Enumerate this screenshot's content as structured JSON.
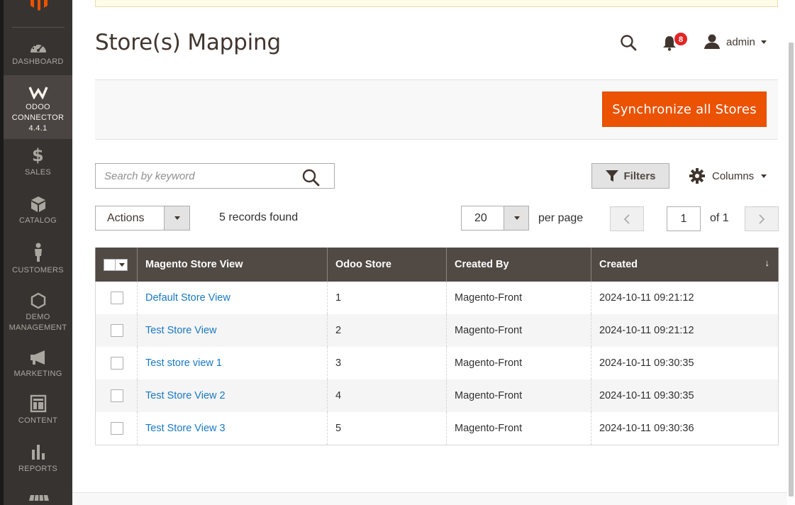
{
  "sidebar": {
    "items": [
      {
        "label": "DASHBOARD",
        "icon": "dashboard-icon"
      },
      {
        "label": "ODOO CONNECTOR 4.4.1",
        "label_lines": [
          "ODOO",
          "CONNECTOR",
          "4.4.1"
        ],
        "icon": "odoo-connector-icon",
        "active": true
      },
      {
        "label": "SALES",
        "icon": "dollar-icon"
      },
      {
        "label": "CATALOG",
        "icon": "box-icon"
      },
      {
        "label": "CUSTOMERS",
        "icon": "person-icon"
      },
      {
        "label": "DEMO MANAGEMENT",
        "label_lines": [
          "DEMO",
          "MANAGEMENT"
        ],
        "icon": "hexagon-icon"
      },
      {
        "label": "MARKETING",
        "icon": "megaphone-icon"
      },
      {
        "label": "CONTENT",
        "icon": "layout-icon"
      },
      {
        "label": "REPORTS",
        "icon": "bar-chart-icon"
      }
    ]
  },
  "header": {
    "title": "Store(s) Mapping",
    "notification_count": "8",
    "user_name": "admin"
  },
  "page_actions": {
    "sync_label": "Synchronize all Stores"
  },
  "toolbar": {
    "search_placeholder": "Search by keyword",
    "filters_label": "Filters",
    "columns_label": "Columns",
    "actions_label": "Actions",
    "records_found": "5 records found",
    "per_page_value": "20",
    "per_page_label": "per page",
    "current_page": "1",
    "of_pages": "of 1"
  },
  "grid": {
    "columns": [
      "Magento Store View",
      "Odoo Store",
      "Created By",
      "Created"
    ],
    "sort_indicator": "↓",
    "rows": [
      {
        "store_view": "Default Store View",
        "odoo_store": "1",
        "created_by": "Magento-Front",
        "created": "2024-10-11 09:21:12"
      },
      {
        "store_view": "Test Store View",
        "odoo_store": "2",
        "created_by": "Magento-Front",
        "created": "2024-10-11 09:21:12"
      },
      {
        "store_view": "Test store view 1",
        "odoo_store": "3",
        "created_by": "Magento-Front",
        "created": "2024-10-11 09:30:35"
      },
      {
        "store_view": "Test Store View 2",
        "odoo_store": "4",
        "created_by": "Magento-Front",
        "created": "2024-10-11 09:30:35"
      },
      {
        "store_view": "Test Store View 3",
        "odoo_store": "5",
        "created_by": "Magento-Front",
        "created": "2024-10-11 09:30:36"
      }
    ]
  },
  "colors": {
    "accent": "#eb5202",
    "sidebar_bg": "#373330",
    "grid_header_bg": "#514943",
    "link": "#1979c3",
    "badge": "#e22626"
  }
}
